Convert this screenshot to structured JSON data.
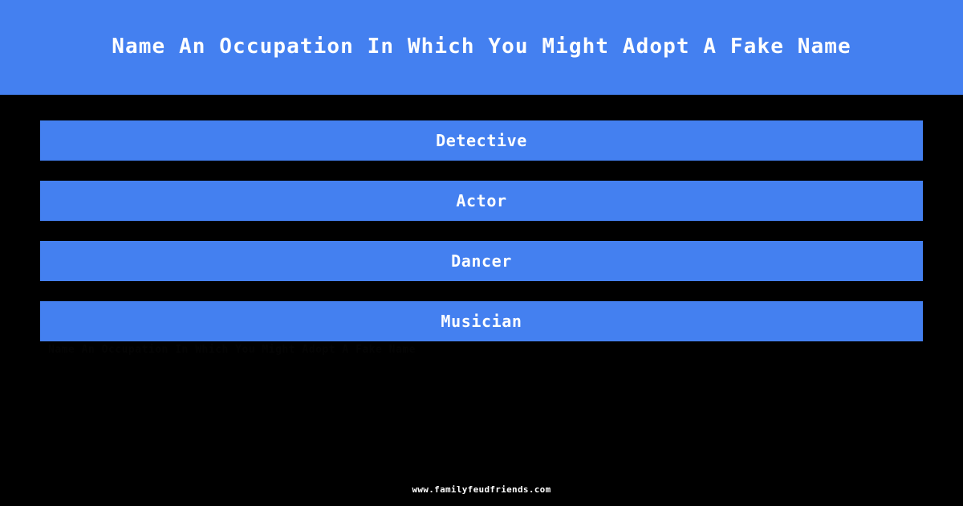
{
  "theme": {
    "background_color": "#000000",
    "accent_color": "#4480f0",
    "text_color": "#ffffff"
  },
  "header": {
    "title": "Name An Occupation In Which You Might Adopt A Fake Name"
  },
  "answers": [
    {
      "rank": 1,
      "label": "Detective"
    },
    {
      "rank": 2,
      "label": "Actor"
    },
    {
      "rank": 3,
      "label": "Dancer"
    },
    {
      "rank": 4,
      "label": "Musician"
    }
  ],
  "artifact": {
    "text": "Name An Occupation In Which You Might Adopt A Fake Name"
  },
  "footer": {
    "url": "www.familyfeudfriends.com"
  }
}
